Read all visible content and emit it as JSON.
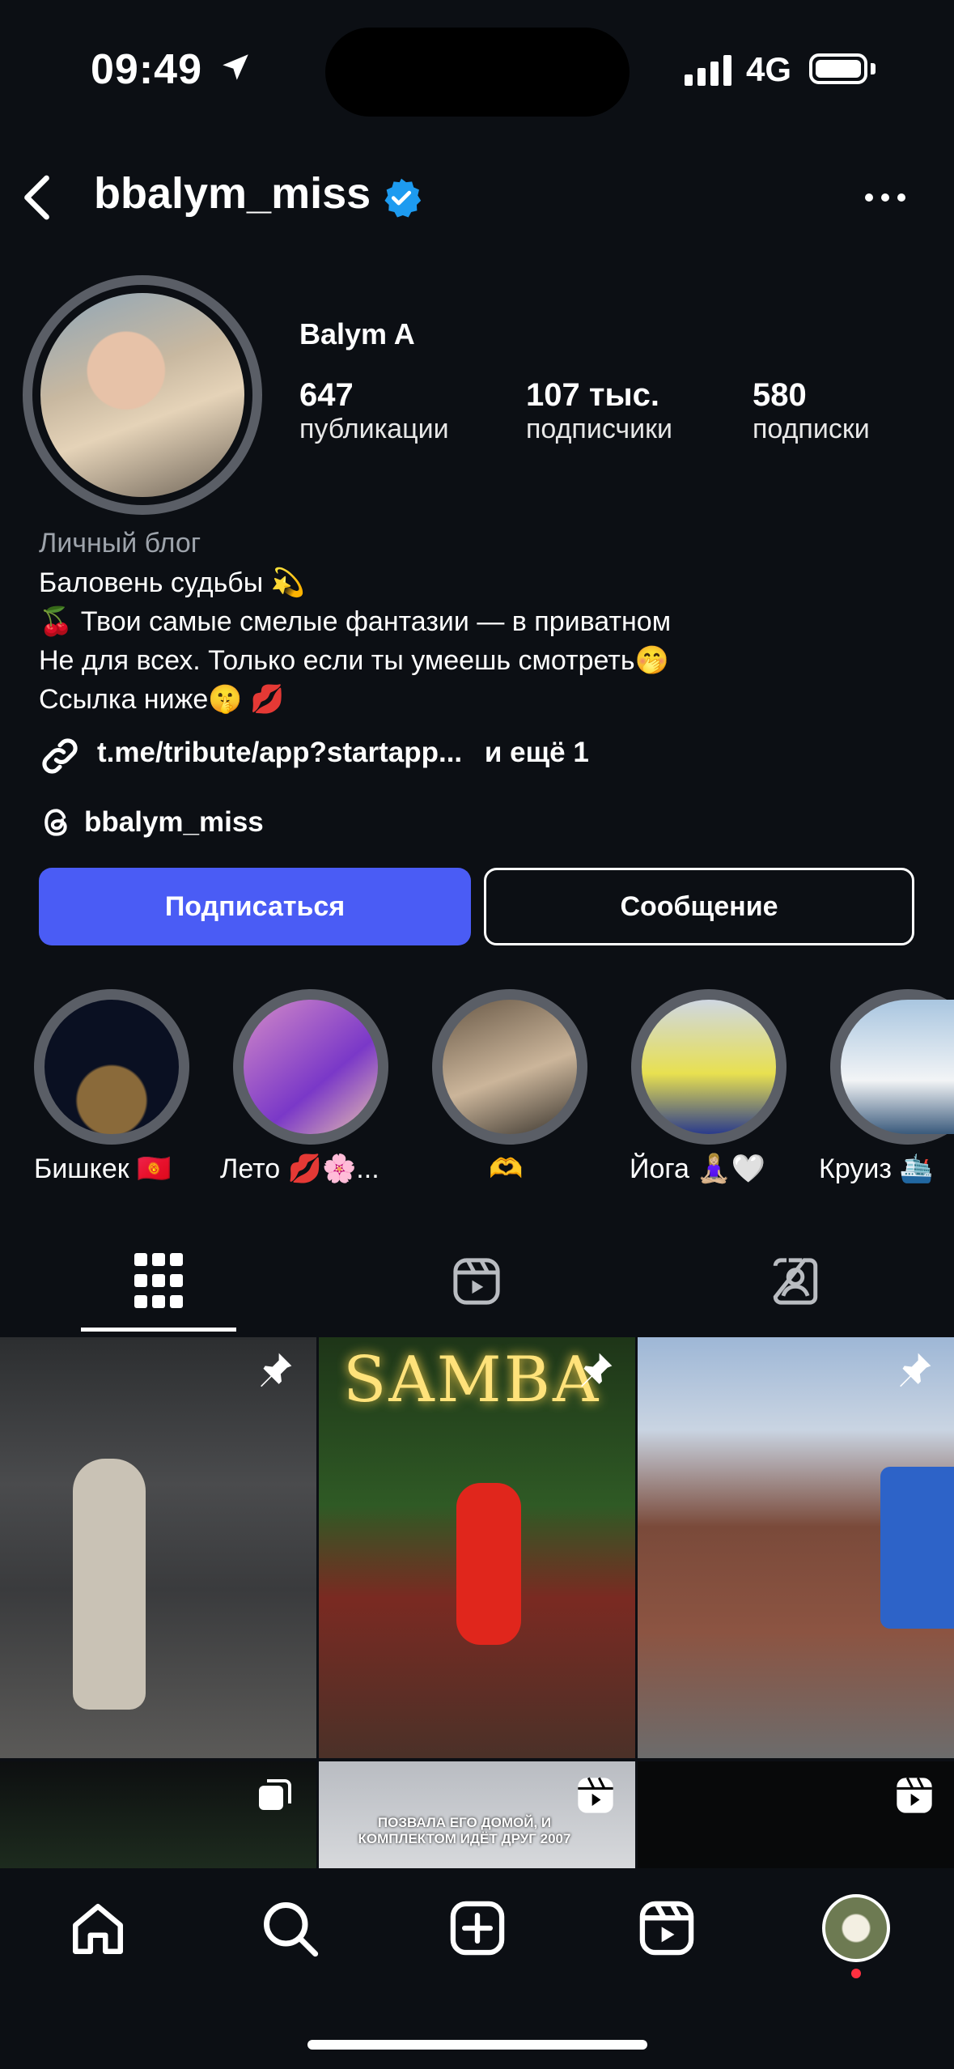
{
  "status": {
    "time": "09:49",
    "network": "4G"
  },
  "header": {
    "username": "bbalym_miss"
  },
  "profile": {
    "display_name": "Balym A",
    "stats": [
      {
        "value": "647",
        "label": "публикации"
      },
      {
        "value": "107 тыс.",
        "label": "подписчики"
      },
      {
        "value": "580",
        "label": "подписки"
      }
    ],
    "category": "Личный блог",
    "bio": [
      "Баловень судьбы 💫",
      "🍒 Твои самые смелые фантазии — в приватном",
      "Не для всех. Только если ты умеешь смотреть🤭",
      "Ссылка ниже🤫 💋"
    ],
    "link_text": "t.me/tribute/app?startapp...",
    "link_more": "и ещё 1",
    "threads_handle": "bbalym_miss"
  },
  "actions": {
    "follow": "Подписаться",
    "message": "Сообщение"
  },
  "highlights": [
    {
      "label": "Бишкек 🇰🇬"
    },
    {
      "label": "Лето 💋🌸..."
    },
    {
      "label": "🫶"
    },
    {
      "label": "Йога 🧘🏼‍♀️🤍"
    },
    {
      "label": "Круиз 🛳️"
    }
  ],
  "posts": {
    "post5_caption": "ПОЗВАЛА ЕГО ДОМОЙ, И КОМПЛЕКТОМ ИДЁТ ДРУГ 2007",
    "post2_neon": "SAMBA"
  },
  "colors": {
    "accent": "#4a5cf5",
    "verified": "#1d9bf0",
    "background": "#0c0f14",
    "notification_dot": "#ff3040"
  }
}
